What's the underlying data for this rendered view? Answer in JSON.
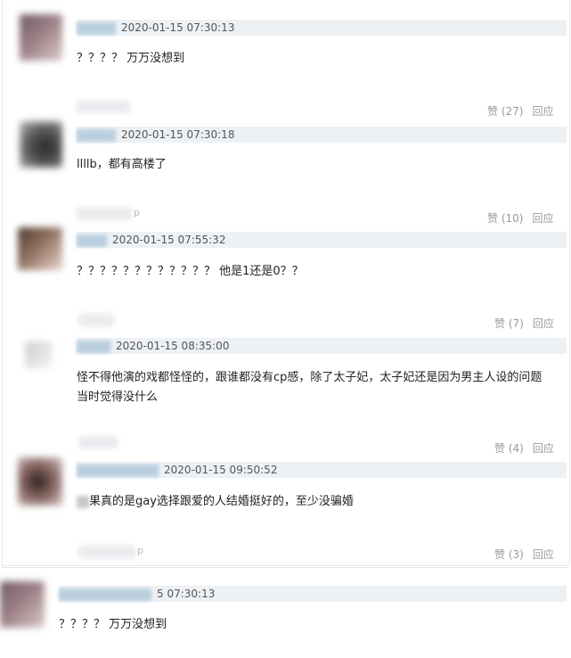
{
  "comments": [
    {
      "timestamp": "2020-01-15 07:30:13",
      "text": "？？？？ 万万没想到"
    },
    {
      "timestamp": "2020-01-15 07:30:18",
      "text": "llllb，都有高楼了"
    },
    {
      "timestamp": "2020-01-15 07:55:32",
      "text": "？？？？？？？？？？？？ 他是1还是0？？"
    },
    {
      "timestamp": "2020-01-15 08:35:00",
      "text_line1": "怪不得他演的戏都怪怪的，跟谁都没有cp感，除了太子妃，太子妃还是因为男主人设的问题",
      "text_line2": "当时觉得没什么"
    },
    {
      "timestamp": "2020-01-15 09:50:52",
      "text": "果真的是gay选择跟爱的人结婚挺好的，至少没骗婚"
    },
    {
      "timestamp": "5 07:30:13",
      "text": "？？？？ 万万没想到"
    }
  ],
  "actions": [
    {
      "like": "赞 (27)",
      "reply": "回应"
    },
    {
      "like": "赞 (10)",
      "reply": "回应"
    },
    {
      "like": "赞 (7)",
      "reply": "回应"
    },
    {
      "like": "赞 (4)",
      "reply": "回应"
    },
    {
      "like": "赞 (3)",
      "reply": "回应"
    }
  ],
  "ghost_suffix": "p",
  "colors": {
    "timestamp_bar": "#eef1f4",
    "action_text": "#999999",
    "body_text": "#222222"
  }
}
